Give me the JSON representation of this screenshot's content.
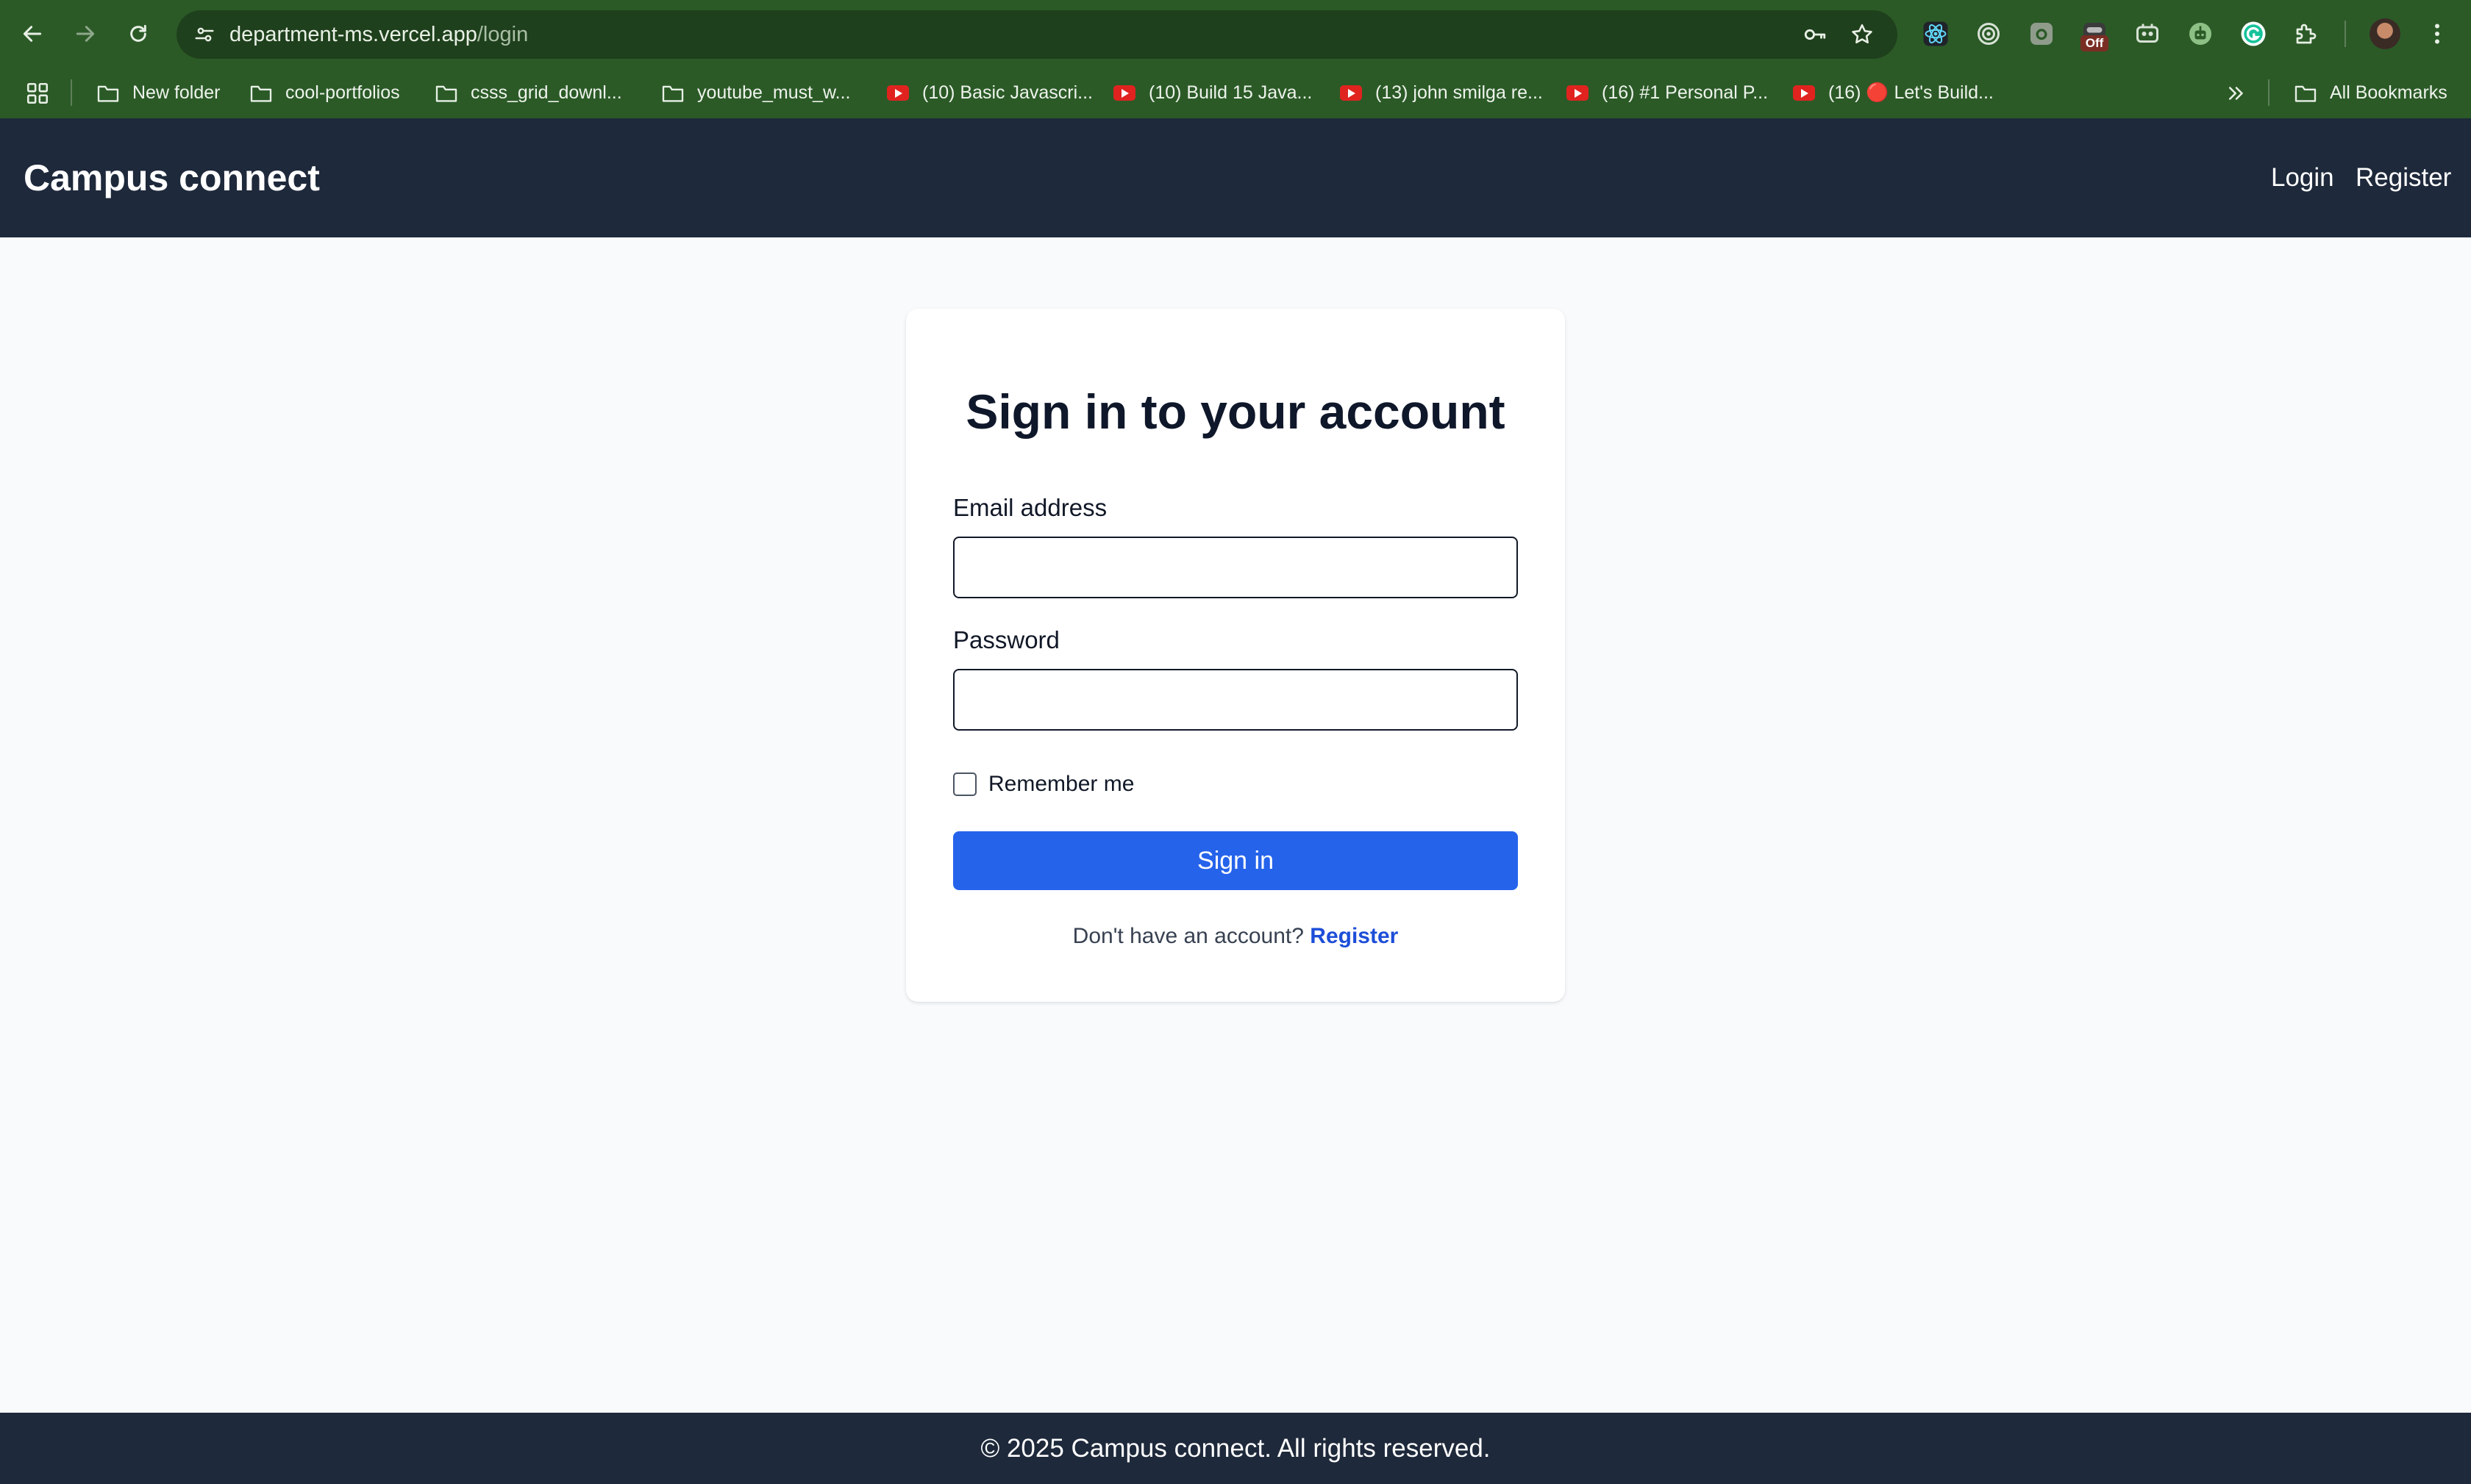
{
  "browser": {
    "url_host": "department-ms.vercel.app",
    "url_path": "/login",
    "extension_badge": "Off",
    "colors": {
      "frame": "#2b5a27",
      "omnibox": "#1f401c"
    }
  },
  "bookmarks": {
    "items": [
      {
        "label": "New folder",
        "icon": "folder-icon"
      },
      {
        "label": "cool-portfolios",
        "icon": "folder-icon"
      },
      {
        "label": "csss_grid_downl...",
        "icon": "folder-icon"
      },
      {
        "label": "youtube_must_w...",
        "icon": "folder-icon"
      },
      {
        "label": "(10) Basic Javascri...",
        "icon": "youtube-icon"
      },
      {
        "label": "(10) Build 15 Java...",
        "icon": "youtube-icon"
      },
      {
        "label": "(13) john smilga re...",
        "icon": "youtube-icon"
      },
      {
        "label": "(16) #1 Personal P...",
        "icon": "youtube-icon"
      },
      {
        "label": "(16) 🔴 Let's Build...",
        "icon": "youtube-icon"
      }
    ],
    "all_bookmarks": "All Bookmarks"
  },
  "header": {
    "brand": "Campus connect",
    "nav": {
      "login": "Login",
      "register": "Register"
    }
  },
  "login_form": {
    "title": "Sign in to your account",
    "email_label": "Email address",
    "email_value": "",
    "password_label": "Password",
    "password_value": "",
    "remember_label": "Remember me",
    "remember_checked": false,
    "submit_label": "Sign in",
    "no_account_text": "Don't have an account?",
    "register_link": "Register"
  },
  "footer": {
    "text": "© 2025 Campus connect. All rights reserved."
  },
  "colors": {
    "header_bg": "#1e293b",
    "page_bg": "#f8fafc",
    "primary": "#2563eb",
    "link": "#1d4ed8"
  }
}
